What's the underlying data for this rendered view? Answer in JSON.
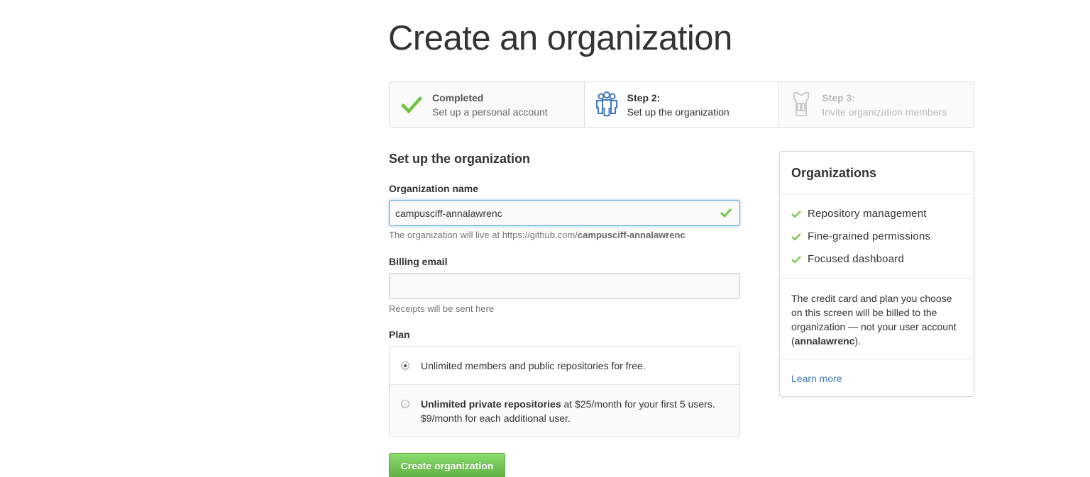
{
  "page_title": "Create an organization",
  "steps": [
    {
      "title": "Completed",
      "description": "Set up a personal account",
      "state": "completed",
      "icon": "check-icon"
    },
    {
      "title": "Step 2:",
      "description": "Set up the organization",
      "state": "current",
      "icon": "people-icon"
    },
    {
      "title": "Step 3:",
      "description": "Invite organization members",
      "state": "future",
      "icon": "jersey-icon"
    }
  ],
  "form": {
    "heading": "Set up the organization",
    "org_name_label": "Organization name",
    "org_name_value": "campusciff-annalawrenc",
    "org_url_prefix": "The organization will live at https://github.com/",
    "org_url_name": "campusciff-annalawrenc",
    "billing_email_label": "Billing email",
    "billing_email_value": "",
    "billing_note": "Receipts will be sent here",
    "plan_label": "Plan",
    "plans": [
      {
        "text": "Unlimited members and public repositories for free.",
        "selected": true
      },
      {
        "bold": "Unlimited private repositories",
        "line1": " at $25/month for your first 5 users.",
        "line2": "$9/month for each additional user.",
        "selected": false
      }
    ],
    "submit_label": "Create organization"
  },
  "sidebar": {
    "title": "Organizations",
    "features": [
      "Repository management",
      "Fine-grained permissions",
      "Focused dashboard"
    ],
    "billing_text_before": "The credit card and plan you choose on this screen will be billed to the organization — not your user account (",
    "billing_username": "annalawrenc",
    "billing_text_after": ").",
    "learn_more": "Learn more"
  },
  "colors": {
    "check_green": "#6cc644",
    "link_blue": "#4078c0",
    "button_green": "#60b044",
    "focus_blue": "#51a7e8"
  }
}
